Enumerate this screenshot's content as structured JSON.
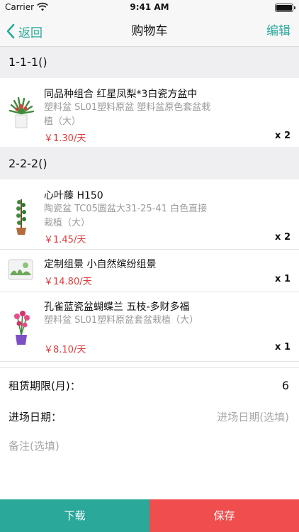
{
  "status_bar": {
    "carrier": "Carrier",
    "time": "9:41 AM"
  },
  "nav": {
    "back_label": "返回",
    "title": "购物车",
    "edit_label": "编辑"
  },
  "groups": [
    {
      "title": "1-1-1()",
      "items": [
        {
          "name": "同品种组合 红星凤梨*3白瓷方盆中",
          "spec": "塑料盆 SL01塑料原盆 塑料盆原色套盆栽植（大）",
          "price": "￥1.30/天",
          "qty": "x 2"
        }
      ]
    },
    {
      "title": "2-2-2()",
      "items": [
        {
          "name": "心叶藤 H150",
          "spec": "陶瓷盆 TC05圆盆大31-25-41 白色直接栽植（大）",
          "price": "￥1.45/天",
          "qty": "x 2"
        },
        {
          "name": "定制组景 小自然缤纷组景",
          "spec": "",
          "price": "￥14.80/天",
          "qty": "x 1"
        },
        {
          "name": "孔雀蓝瓷盆蝴蝶兰 五枝-多财多福",
          "spec": "塑料盆 SL01塑料原盆套盆栽植（大）",
          "price": "￥8.10/天",
          "qty": "x 1"
        }
      ]
    }
  ],
  "form": {
    "lease_label": "租赁期限(月)：",
    "lease_value": "6",
    "date_label": "进场日期：",
    "date_placeholder": "进场日期(选填)",
    "remark_placeholder": "备注(选填)"
  },
  "buttons": {
    "download": "下载",
    "save": "保存"
  },
  "colors": {
    "accent": "#2aa89a",
    "price": "#e23b3b",
    "save": "#f04e4e"
  }
}
